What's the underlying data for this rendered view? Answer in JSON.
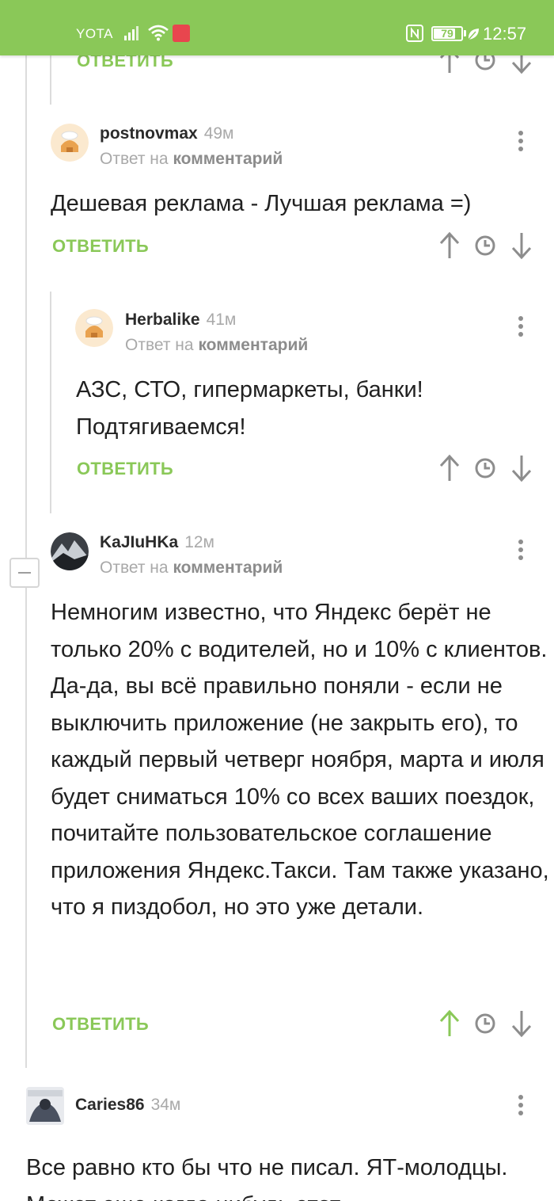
{
  "status_bar": {
    "carrier": "YOTA",
    "battery": "79",
    "battery_level": 0.79,
    "time": "12:57"
  },
  "comments": [
    {
      "reply_label": "ОТВЕТИТЬ"
    },
    {
      "author": "postnovmax",
      "time": "49м",
      "reply_prefix": "Ответ на",
      "reply_target": "комментарий",
      "text": "Дешевая реклама - Лучшая реклама =)",
      "reply_label": "ОТВЕТИТЬ"
    },
    {
      "author": "Herbalike",
      "time": "41м",
      "reply_prefix": "Ответ на",
      "reply_target": "комментарий",
      "text": "АЗС, СТО, гипермаркеты, банки! Подтягиваемся!",
      "reply_label": "ОТВЕТИТЬ"
    },
    {
      "author": "KaJIuHKa",
      "time": "12м",
      "reply_prefix": "Ответ на",
      "reply_target": "комментарий",
      "text": "Немногим известно, что Яндекс берёт не только 20% с водителей, но и 10% с клиентов. Да-да, вы всё правильно поняли - если не выключить приложение (не закрыть его), то каждый первый четверг ноября, марта и июля будет сниматься 10% со всех ваших поездок, почитайте пользовательское соглашение приложения Яндекс.Такси. Там также указано, что я пиздобол, но это уже детали.",
      "reply_label": "ОТВЕТИТЬ"
    },
    {
      "author": "Caries86",
      "time": "34м",
      "text": "Все равно кто бы что не писал. ЯТ-молодцы. Может еще когда нибудь этот"
    }
  ],
  "colors": {
    "accent": "#8ac858",
    "upvote_active": "#8ac858",
    "icon": "#8d8d8d"
  },
  "icons": {
    "upvote": "arrow-up-icon",
    "save": "clock-icon",
    "downvote": "arrow-down-icon",
    "menu": "more-vertical-icon"
  }
}
